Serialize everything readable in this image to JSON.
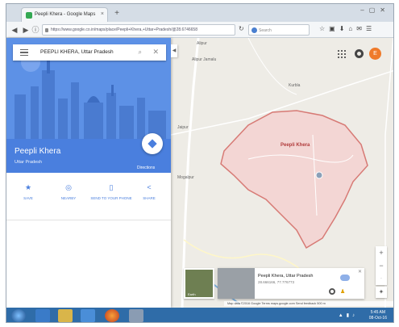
{
  "browser": {
    "tab_title": "Peepli Khera - Google Maps",
    "url": "https://www.google.co.in/maps/place/Peepli+Khera,+Uttar+Pradesh/@28.6746658",
    "search_placeholder": "Search"
  },
  "sidebar": {
    "search_value": "PEEPLI KHERA, Uttar Pradesh",
    "place_name": "Peepli Khera",
    "place_region": "Uttar Pradesh",
    "directions_label": "Directions",
    "actions": [
      {
        "label": "SAVE",
        "icon": "star-icon"
      },
      {
        "label": "NEARBY",
        "icon": "nearby-icon"
      },
      {
        "label": "SEND TO YOUR PHONE",
        "icon": "phone-icon"
      },
      {
        "label": "SHARE",
        "icon": "share-icon"
      }
    ]
  },
  "map": {
    "region_label": "Peepli Khera",
    "labels": [
      {
        "text": "Alipur"
      },
      {
        "text": "Alipur Jamalu"
      },
      {
        "text": "Kurbla"
      },
      {
        "text": "Jaipur"
      },
      {
        "text": "Mogalpur"
      }
    ],
    "region_fill": "#f3d6d4",
    "region_stroke": "#d77a75"
  },
  "account": {
    "avatar_letter": "E",
    "avatar_color": "#ef7a2a"
  },
  "streetview": {
    "title": "Peepli Khera, Uttar Pradesh",
    "coords": "28.666166, 77.776773"
  },
  "earth": {
    "label": "Earth"
  },
  "footer": "Map data ©2016 Google   Terms   maps.google.com   Send feedback   500 m",
  "taskbar": {
    "time": "5:45 AM",
    "date": "08-Oct-16"
  }
}
